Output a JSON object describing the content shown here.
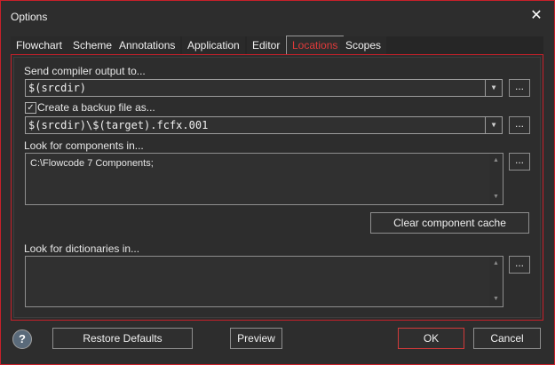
{
  "window": {
    "title": "Options",
    "close_glyph": "✕"
  },
  "tabs": [
    {
      "label": "Flowchart"
    },
    {
      "label": "Scheme"
    },
    {
      "label": "Annotations"
    },
    {
      "label": "Application"
    },
    {
      "label": "Editor"
    },
    {
      "label": "Locations",
      "active": true
    },
    {
      "label": "Scopes"
    }
  ],
  "locations": {
    "compiler_output_label": "Send compiler output to...",
    "compiler_output_value": "$(srcdir)",
    "backup_checkbox_checked": true,
    "backup_label": "Create a backup file as...",
    "backup_value": "$(srcdir)\\$(target).fcfx.001",
    "components_label": "Look for components in...",
    "components_value": "C:\\Flowcode 7 Components;",
    "clear_cache_label": "Clear component cache",
    "dictionaries_label": "Look for dictionaries in...",
    "dictionaries_value": "",
    "browse_label": "..."
  },
  "footer": {
    "help_glyph": "?",
    "restore_label": "Restore Defaults",
    "preview_label": "Preview",
    "ok_label": "OK",
    "cancel_label": "Cancel"
  },
  "colors": {
    "accent": "#c8202a",
    "active_tab_text": "#e03a3a"
  },
  "icons": {
    "help": "help-icon",
    "close": "close-icon",
    "dropdown": "chevron-down-icon"
  }
}
